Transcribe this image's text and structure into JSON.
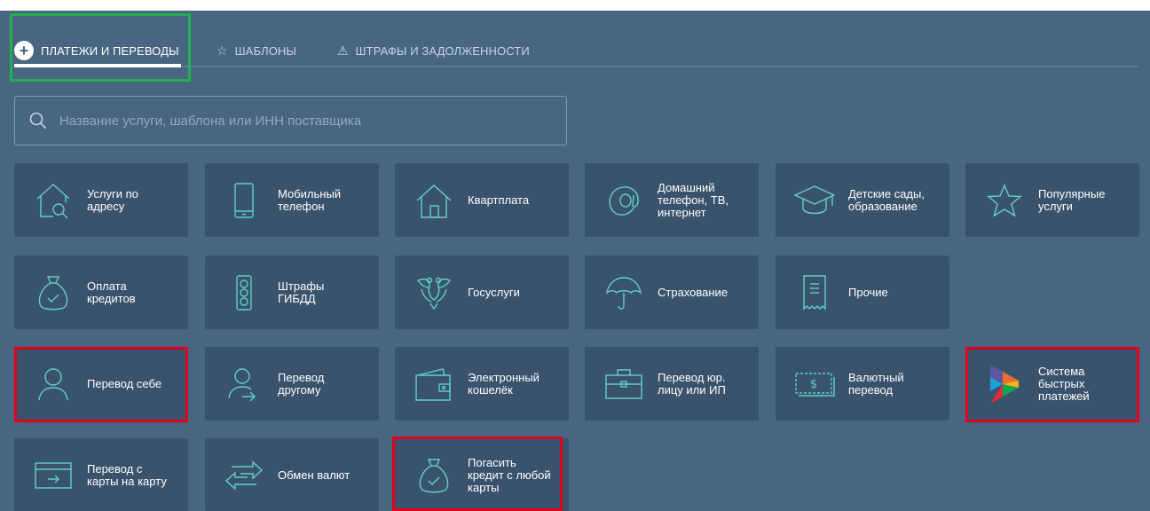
{
  "tabs": [
    {
      "label": "ПЛАТЕЖИ И ПЕРЕВОДЫ",
      "icon": "plus-circle-icon",
      "active": true
    },
    {
      "label": "ШАБЛОНЫ",
      "icon": "star-icon",
      "active": false
    },
    {
      "label": "ШТРАФЫ И ЗАДОЛЖЕННОСТИ",
      "icon": "warning-icon",
      "active": false
    }
  ],
  "search": {
    "placeholder": "Название услуги, шаблона или ИНН поставщика",
    "value": ""
  },
  "tiles": [
    {
      "label": "Услуги по\nадресу",
      "icon": "house-search-icon"
    },
    {
      "label": "Мобильный\nтелефон",
      "icon": "mobile-phone-icon"
    },
    {
      "label": "Квартплата",
      "icon": "house-icon"
    },
    {
      "label": "Домашний\nтелефон, ТВ,\nинтернет",
      "icon": "at-sign-icon"
    },
    {
      "label": "Детские сады,\nобразование",
      "icon": "graduation-cap-icon"
    },
    {
      "label": "Популярные\nуслуги",
      "icon": "star-icon"
    },
    {
      "label": "Оплата\nкредитов",
      "icon": "money-bag-icon"
    },
    {
      "label": "Штрафы\nГИБДД",
      "icon": "traffic-light-icon"
    },
    {
      "label": "Госуслуги",
      "icon": "eagle-emblem-icon"
    },
    {
      "label": "Страхование",
      "icon": "umbrella-icon"
    },
    {
      "label": "Прочие",
      "icon": "receipt-icon"
    },
    {
      "label": "Перевод себе",
      "icon": "user-icon"
    },
    {
      "label": "Перевод\nдругому",
      "icon": "user-arrow-icon"
    },
    {
      "label": "Электронный\nкошелёк",
      "icon": "wallet-icon"
    },
    {
      "label": "Перевод юр.\nлицу или ИП",
      "icon": "briefcase-icon"
    },
    {
      "label": "Валютный\nперевод",
      "icon": "dollar-bill-icon"
    },
    {
      "label": "Система\nбыстрых\nплатежей",
      "icon": "sbp-logo-icon"
    },
    {
      "label": "Перевод с\nкарты на карту",
      "icon": "card-transfer-icon"
    },
    {
      "label": "Обмен валют",
      "icon": "exchange-arrows-icon"
    },
    {
      "label": "Погасить\nкредит с любой\nкарты",
      "icon": "money-bag-icon"
    }
  ],
  "colors": {
    "panel": "#486581",
    "tile": "#3a536d",
    "icon_accent": "#5fd0c8",
    "highlight_green": "#22b14c",
    "highlight_red": "#e2001a"
  }
}
